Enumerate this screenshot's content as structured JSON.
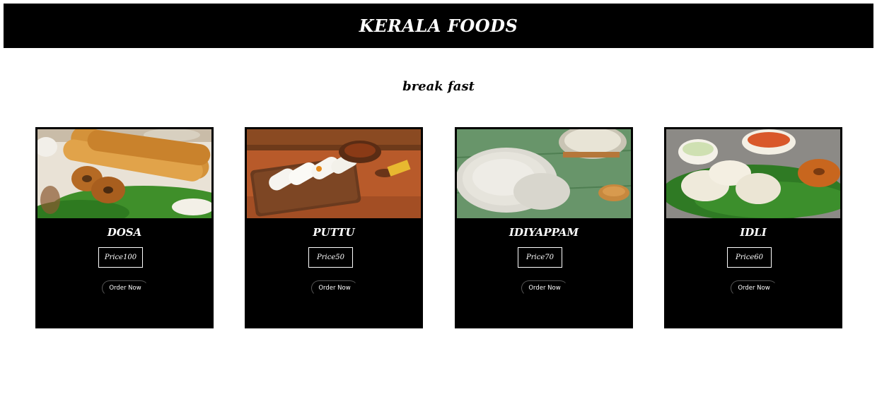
{
  "header": {
    "title": "KERALA FOODS"
  },
  "section": {
    "title": "break fast"
  },
  "items": [
    {
      "name": "DOSA",
      "price": "Price100",
      "order_label": "Order Now"
    },
    {
      "name": "PUTTU",
      "price": "Price50",
      "order_label": "Order Now"
    },
    {
      "name": "IDIYAPPAM",
      "price": "Price70",
      "order_label": "Order Now"
    },
    {
      "name": "IDLI",
      "price": "Price60",
      "order_label": "Order Now"
    }
  ]
}
